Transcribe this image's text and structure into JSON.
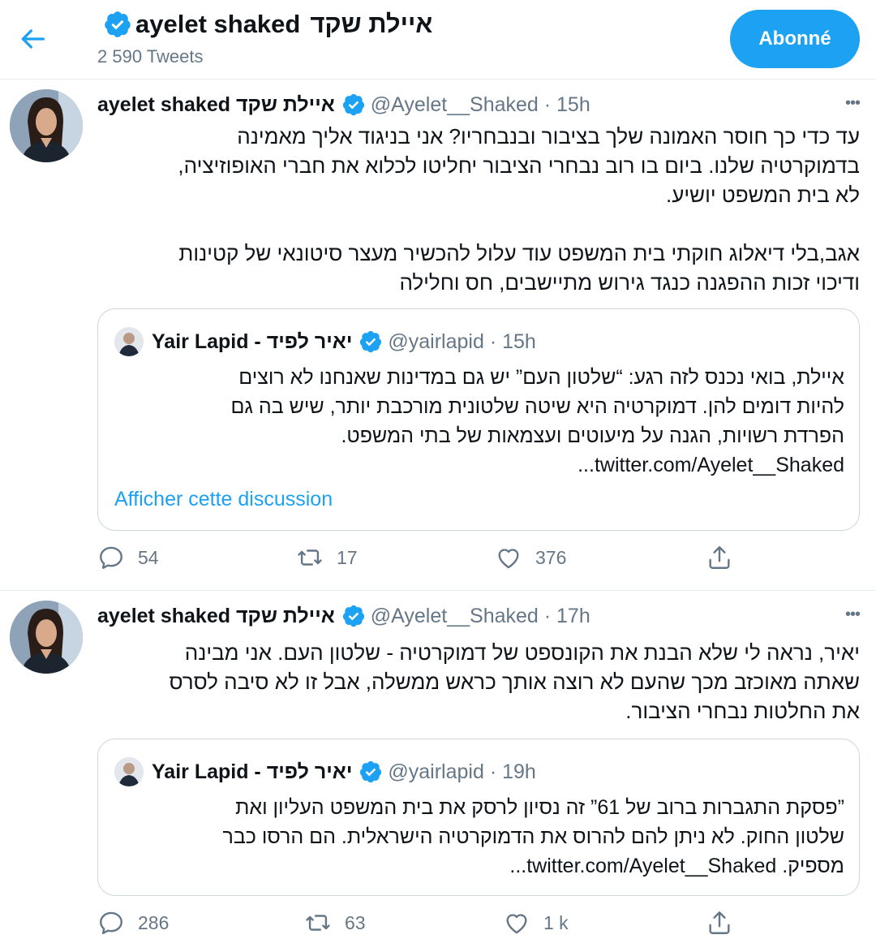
{
  "header": {
    "title_en": "ayelet shaked",
    "title_he": "איילת שקד",
    "tweet_count": "2 590 Tweets",
    "follow_label": "Abonné"
  },
  "colors": {
    "accent": "#1da1f2",
    "muted": "#657786",
    "border": "#e6ecf0"
  },
  "tweets": [
    {
      "name": "ayelet shaked איילת שקד",
      "handle_time": "@Ayelet__Shaked · 15h",
      "text": "עד כדי כך חוסר האמונה שלך בציבור ובנבחריו? אני בניגוד אליך מאמינה\nבדמוקרטיה שלנו. ביום בו רוב נבחרי הציבור יחליטו לכלוא את חברי האופוזיציה,\nלא בית המשפט יושיע.\n\nאגב,בלי דיאלוג חוקתי בית המשפט עוד עלול להכשיר מעצר סיטונאי של קטינות\nודיכוי זכות ההפגנה כנגד גירוש מתיישבים, חס וחלילה",
      "quote": {
        "name": "Yair Lapid - יאיר לפיד",
        "handle_time": "@yairlapid · 15h",
        "text": "איילת, בואי נכנס לזה רגע: “שלטון העם” יש גם במדינות שאנחנו לא רוצים\nלהיות דומים להן. דמוקרטיה היא שיטה שלטונית מורכבת יותר, שיש בה גם\nהפרדת רשויות, הגנה על מיעוטים ועצמאות של בתי המשפט.\ntwitter.com/Ayelet__Shaked...",
        "link": "Afficher cette discussion"
      },
      "replies": "54",
      "retweets": "17",
      "likes": "376"
    },
    {
      "name": "ayelet shaked איילת שקד",
      "handle_time": "@Ayelet__Shaked · 17h",
      "text": "יאיר, נראה לי שלא הבנת את הקונספט של דמוקרטיה - שלטון העם. אני מבינה\nשאתה מאוכזב מכך שהעם לא רוצה אותך כראש ממשלה, אבל זו לא סיבה לסרס\nאת החלטות נבחרי הציבור.",
      "quote": {
        "name": "Yair Lapid - יאיר לפיד",
        "handle_time": "@yairlapid · 19h",
        "text": "”פסקת התגברות ברוב של 61” זה נסיון לרסק את בית המשפט העליון ואת\nשלטון החוק. לא ניתן להם להרוס את הדמוקרטיה הישראלית. הם הרסו כבר\nמספיק. twitter.com/Ayelet__Shaked..."
      },
      "replies": "286",
      "retweets": "63",
      "likes": "1 k"
    }
  ]
}
